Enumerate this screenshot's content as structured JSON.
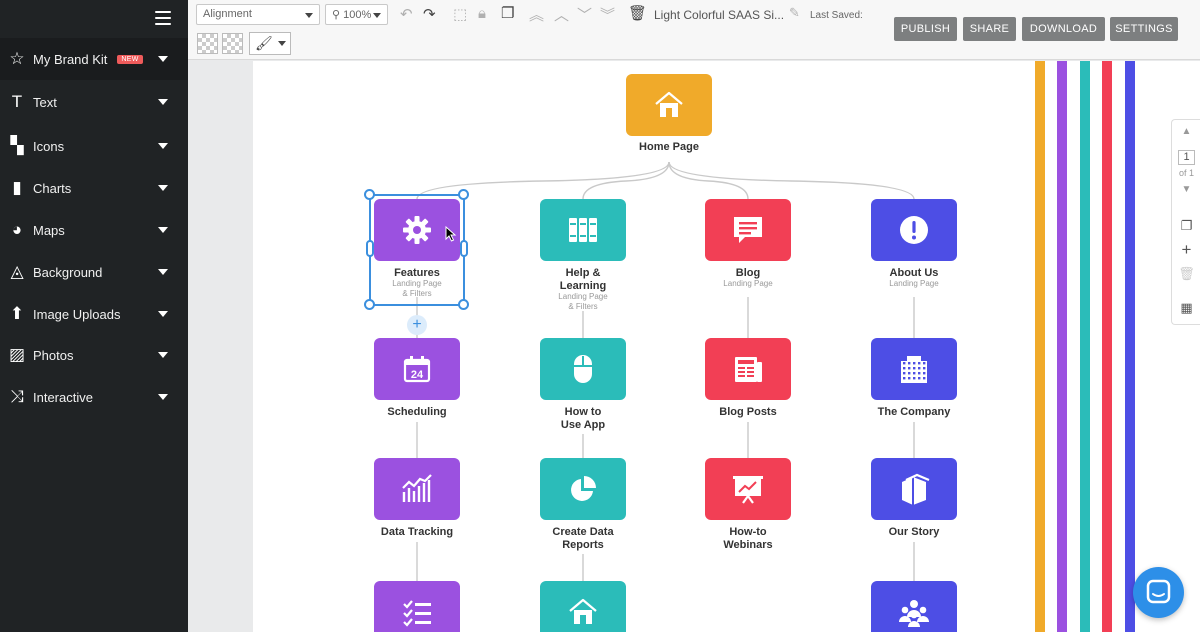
{
  "sidebar": {
    "items": [
      {
        "label": "My Brand Kit",
        "badge": "NEW",
        "icon": "star-icon"
      },
      {
        "label": "Text",
        "icon": "text-icon"
      },
      {
        "label": "Icons",
        "icon": "icons-grid-icon"
      },
      {
        "label": "Charts",
        "icon": "bar-chart-icon"
      },
      {
        "label": "Maps",
        "icon": "globe-icon"
      },
      {
        "label": "Background",
        "icon": "drop-icon"
      },
      {
        "label": "Image Uploads",
        "icon": "upload-icon"
      },
      {
        "label": "Photos",
        "icon": "photo-icon"
      },
      {
        "label": "Interactive",
        "icon": "shuffle-icon"
      }
    ]
  },
  "toolbar": {
    "alignment": "Alignment",
    "zoom": "100%",
    "doc_title": "Light Colorful SAAS Si...",
    "last_saved": "Last Saved:",
    "buttons": {
      "publish": "PUBLISH",
      "share": "SHARE",
      "download": "DOWNLOAD",
      "settings": "SETTINGS"
    }
  },
  "sitemap": {
    "root": {
      "label": "Home Page",
      "color": "#f0aa2a",
      "icon": "home-icon"
    },
    "columns": [
      {
        "color": "#9b51e0",
        "nodes": [
          {
            "label": "Features",
            "sub": "Landing Page\n& Filters",
            "icon": "gear-icon"
          },
          {
            "label": "Scheduling",
            "sub": "",
            "icon": "calendar-icon",
            "icon_text": "24"
          },
          {
            "label": "Data Tracking",
            "sub": "",
            "icon": "analytics-icon"
          },
          {
            "label": "",
            "sub": "",
            "icon": "checklist-icon"
          }
        ]
      },
      {
        "color": "#2bbcb9",
        "nodes": [
          {
            "label": "Help &\nLearning",
            "sub": "Landing Page\n& Filters",
            "icon": "books-icon"
          },
          {
            "label": "How to\nUse App",
            "sub": "",
            "icon": "mouse-icon"
          },
          {
            "label": "Create Data\nReports",
            "sub": "",
            "icon": "pie-chart-icon"
          },
          {
            "label": "",
            "sub": "",
            "icon": "home-icon"
          }
        ]
      },
      {
        "color": "#f23f55",
        "nodes": [
          {
            "label": "Blog",
            "sub": "Landing Page",
            "icon": "comment-icon"
          },
          {
            "label": "Blog Posts",
            "sub": "",
            "icon": "newspaper-icon"
          },
          {
            "label": "How-to\nWebinars",
            "sub": "",
            "icon": "presentation-icon"
          }
        ]
      },
      {
        "color": "#4d4ee5",
        "nodes": [
          {
            "label": "About Us",
            "sub": "Landing Page",
            "icon": "exclamation-icon"
          },
          {
            "label": "The Company",
            "sub": "",
            "icon": "building-icon"
          },
          {
            "label": "Our Story",
            "sub": "",
            "icon": "book-icon"
          },
          {
            "label": "",
            "sub": "",
            "icon": "team-icon"
          }
        ]
      }
    ]
  },
  "stripes": [
    "#f0aa2a",
    "#9b51e0",
    "#2bbcb9",
    "#f23f55",
    "#4d4ee5"
  ],
  "pager": {
    "page": "1",
    "of": "of 1"
  }
}
